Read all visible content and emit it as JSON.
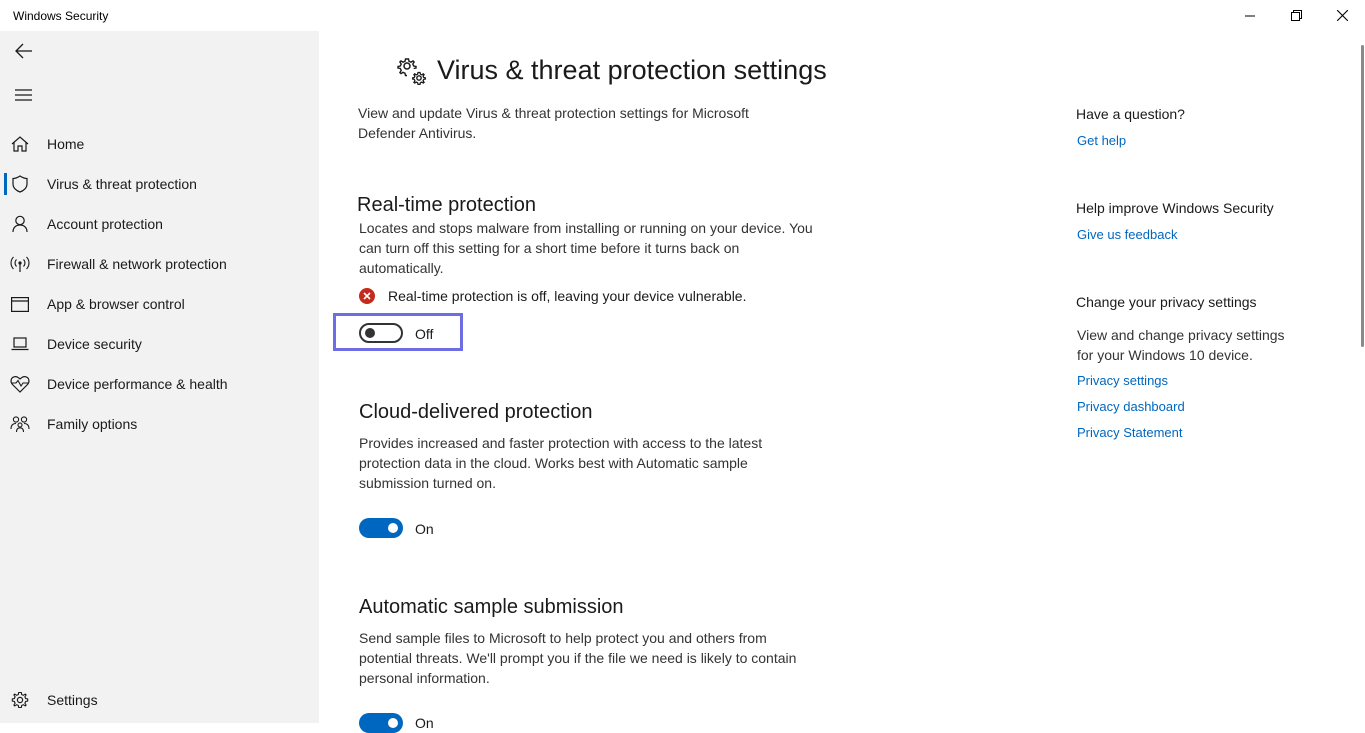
{
  "window": {
    "title": "Windows Security"
  },
  "sidebar": {
    "items": [
      {
        "label": "Home",
        "icon": "home-icon"
      },
      {
        "label": "Virus & threat protection",
        "icon": "shield-icon",
        "active": true
      },
      {
        "label": "Account protection",
        "icon": "person-icon"
      },
      {
        "label": "Firewall & network protection",
        "icon": "antenna-icon"
      },
      {
        "label": "App & browser control",
        "icon": "app-window-icon"
      },
      {
        "label": "Device security",
        "icon": "laptop-icon"
      },
      {
        "label": "Device performance & health",
        "icon": "heart-pulse-icon"
      },
      {
        "label": "Family options",
        "icon": "family-icon"
      }
    ],
    "settings_label": "Settings"
  },
  "main": {
    "title": "Virus & threat protection settings",
    "description_line1": "View and update Virus & threat protection settings for Microsoft",
    "description_line2": "Defender Antivirus.",
    "realtime": {
      "title": "Real-time protection",
      "desc_line1": "Locates and stops malware from installing or running on your device. You",
      "desc_line2": "can turn off this setting for a short time before it turns back on",
      "desc_line3": "automatically.",
      "warning": "Real-time protection is off, leaving your device vulnerable.",
      "toggle_label": "Off",
      "toggle_on": false
    },
    "cloud": {
      "title": "Cloud-delivered protection",
      "desc_line1": "Provides increased and faster protection with access to the latest",
      "desc_line2": "protection data in the cloud. Works best with Automatic sample",
      "desc_line3": "submission turned on.",
      "toggle_label": "On",
      "toggle_on": true
    },
    "sample": {
      "title": "Automatic sample submission",
      "desc_line1": "Send sample files to Microsoft to help protect you and others from",
      "desc_line2": "potential threats. We'll prompt you if the file we need is likely to contain",
      "desc_line3": "personal information.",
      "toggle_label": "On",
      "toggle_on": true
    }
  },
  "right": {
    "question_heading": "Have a question?",
    "get_help": "Get help",
    "improve_heading": "Help improve Windows Security",
    "feedback": "Give us feedback",
    "privacy_heading": "Change your privacy settings",
    "privacy_desc_line1": "View and change privacy settings",
    "privacy_desc_line2": "for your Windows 10 device.",
    "privacy_settings": "Privacy settings",
    "privacy_dashboard": "Privacy dashboard",
    "privacy_statement": "Privacy Statement"
  },
  "colors": {
    "accent": "#0067c0",
    "focus_outline": "#6d6ee4",
    "error": "#c42b1c",
    "sidebar_bg": "#f2f2f2"
  }
}
